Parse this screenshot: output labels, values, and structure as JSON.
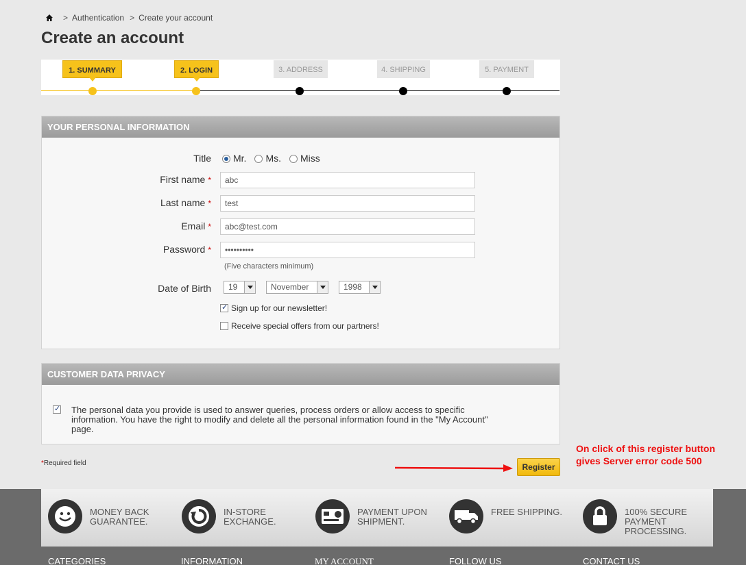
{
  "breadcrumb": {
    "home_icon": "home-icon",
    "separator": ">",
    "items": [
      "Authentication",
      "Create your account"
    ]
  },
  "page_title": "Create an account",
  "steps": [
    {
      "label": "1. SUMMARY",
      "state": "active"
    },
    {
      "label": "2. LOGIN",
      "state": "active"
    },
    {
      "label": "3. ADDRESS",
      "state": "inactive"
    },
    {
      "label": "4. SHIPPING",
      "state": "inactive"
    },
    {
      "label": "5. PAYMENT",
      "state": "inactive"
    }
  ],
  "personal": {
    "header": "YOUR PERSONAL INFORMATION",
    "title_label": "Title",
    "title_options": [
      {
        "label": "Mr.",
        "checked": true
      },
      {
        "label": "Ms.",
        "checked": false
      },
      {
        "label": "Miss",
        "checked": false
      }
    ],
    "required_mark": "*",
    "first_name": {
      "label": "First name",
      "value": "abc"
    },
    "last_name": {
      "label": "Last name",
      "value": "test"
    },
    "email": {
      "label": "Email",
      "value": "abc@test.com"
    },
    "password": {
      "label": "Password",
      "value": "••••••••••",
      "hint": "(Five characters minimum)"
    },
    "dob": {
      "label": "Date of Birth",
      "day": "19",
      "month": "November",
      "year": "1998"
    },
    "newsletter": {
      "label": "Sign up for our newsletter!",
      "checked": true
    },
    "offers": {
      "label": "Receive special offers from our partners!",
      "checked": false
    }
  },
  "privacy": {
    "header": "CUSTOMER DATA PRIVACY",
    "checked": true,
    "text": "The personal data you provide is used to answer queries, process orders or allow access to specific information. You have the right to modify and delete all the personal information found in the \"My Account\" page."
  },
  "required_note": {
    "star": "*",
    "text": "Required field"
  },
  "register_label": "Register",
  "annotation": {
    "text": "On click of this register button gives Server error code 500",
    "color": "#ee1111"
  },
  "features": [
    {
      "icon": "smiley-icon",
      "text": "MONEY BACK GUARANTEE."
    },
    {
      "icon": "refresh-icon",
      "text": "IN-STORE EXCHANGE."
    },
    {
      "icon": "credit-card-icon",
      "text": "PAYMENT UPON SHIPMENT."
    },
    {
      "icon": "truck-icon",
      "text": "FREE SHIPPING."
    },
    {
      "icon": "lock-icon",
      "text": "100% SECURE PAYMENT PROCESSING."
    }
  ],
  "footer_nav": [
    "CATEGORIES",
    "INFORMATION",
    "MY ACCOUNT",
    "FOLLOW US",
    "CONTACT US"
  ],
  "colors": {
    "accent": "#f6c21b",
    "panel_header": "#a8a8a8",
    "required": "#cc0000"
  }
}
